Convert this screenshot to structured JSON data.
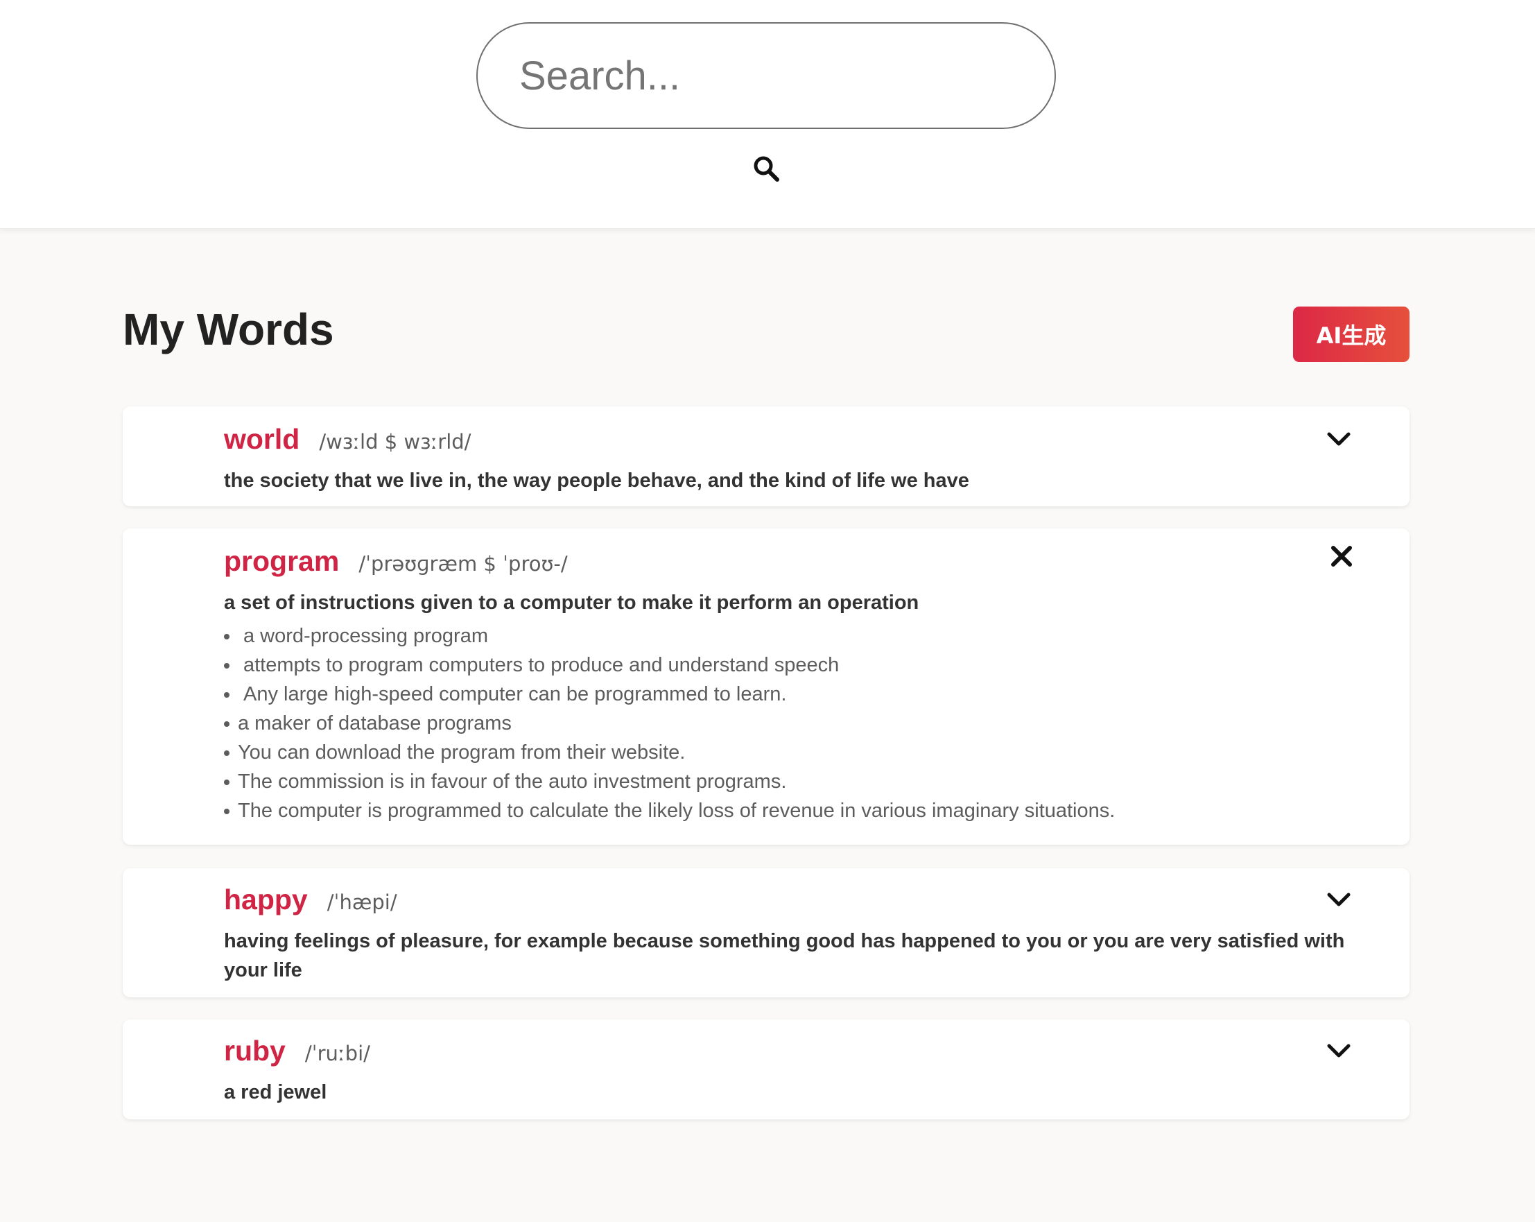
{
  "search": {
    "placeholder": "Search..."
  },
  "header": {
    "title": "My Words",
    "ai_button_label": "AI生成"
  },
  "words": [
    {
      "word": "world",
      "phonetic": "/wɜːld $ wɜːrld/",
      "definition": "the society that we live in, the way people behave, and the kind of life we have",
      "expanded": false,
      "toggle_icon": "chevron-down-icon"
    },
    {
      "word": "program",
      "phonetic": "/ˈprəʊɡræm $ ˈproʊ-/",
      "definition": "a set of instructions given to a computer to make it perform an operation",
      "expanded": true,
      "toggle_icon": "close-icon",
      "examples": [
        "a word-processing program",
        "attempts to program computers to produce and understand speech",
        "Any large high-speed computer can be programmed to learn.",
        "a maker of database programs",
        "You can download the program from their website.",
        "The commission is in favour of the auto investment programs.",
        "The computer is programmed to calculate the likely loss of revenue in various imaginary situations."
      ]
    },
    {
      "word": "happy",
      "phonetic": "/ˈhæpi/",
      "definition": "having feelings of pleasure, for example because something good has happened to you or you are very satisfied with your life",
      "expanded": false,
      "toggle_icon": "chevron-down-icon"
    },
    {
      "word": "ruby",
      "phonetic": "/ˈruːbi/",
      "definition": "a red jewel",
      "expanded": false,
      "toggle_icon": "chevron-down-icon"
    }
  ],
  "colors": {
    "accent_word": "#cf2444",
    "ai_button_gradient_start": "#dc2846",
    "ai_button_gradient_end": "#e6503c",
    "page_background": "#faf9f7"
  }
}
